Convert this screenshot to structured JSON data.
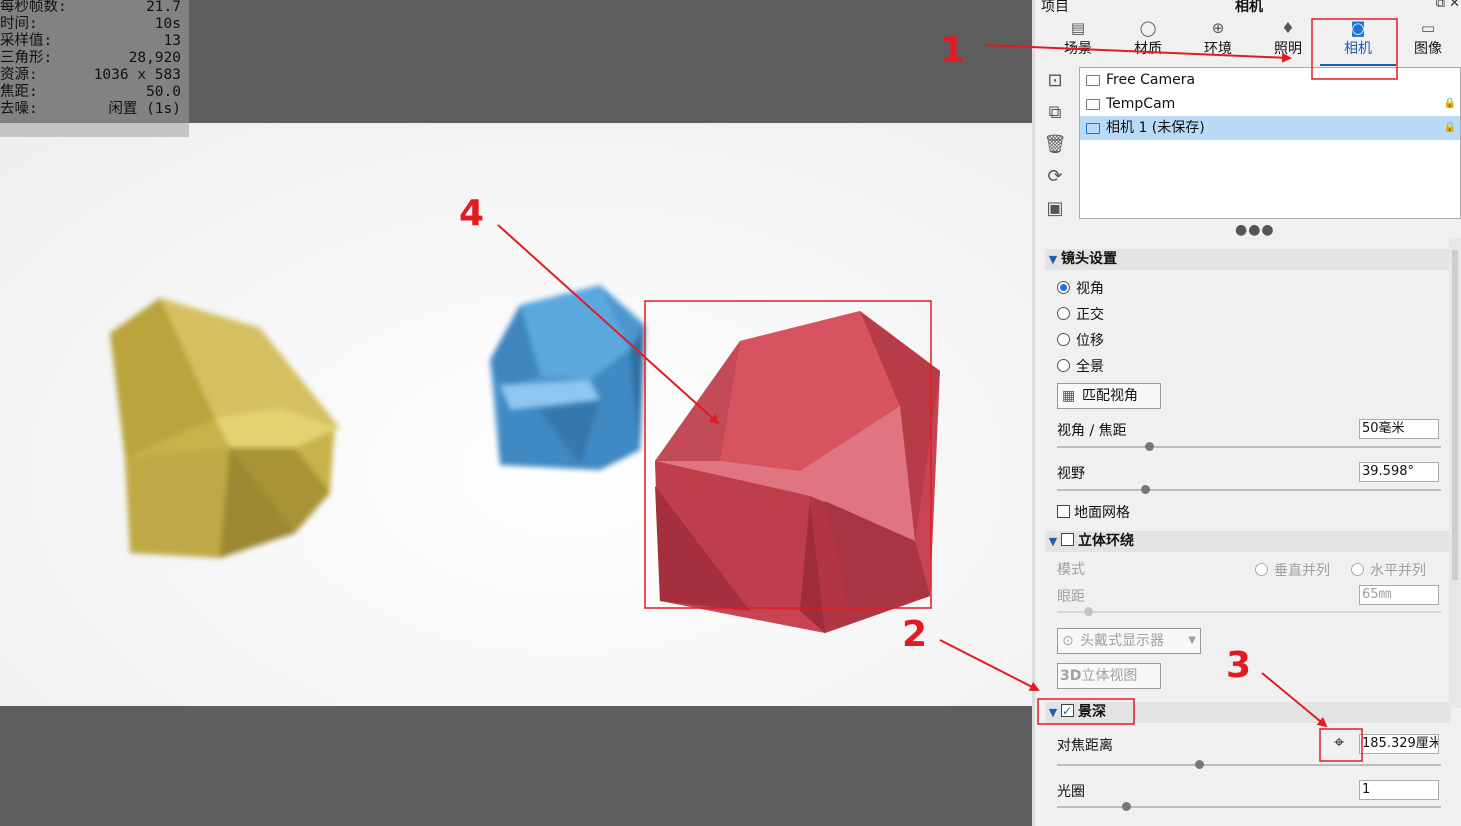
{
  "stats": [
    {
      "label": "每秒帧数:",
      "value": "21.7"
    },
    {
      "label": "时间:",
      "value": "10s"
    },
    {
      "label": "采样值:",
      "value": "13"
    },
    {
      "label": "三角形:",
      "value": "28,920"
    },
    {
      "label": "资源:",
      "value": "1036 x 583"
    },
    {
      "label": "焦距:",
      "value": "50.0"
    },
    {
      "label": "去噪:",
      "value": "闲置 (1s)"
    }
  ],
  "panel": {
    "title_left": "项目",
    "title_center": "相机",
    "title_icons": "⧉ ✕",
    "tabs": [
      {
        "label": "场景",
        "icon": "scene-icon"
      },
      {
        "label": "材质",
        "icon": "material-icon"
      },
      {
        "label": "环境",
        "icon": "environment-icon"
      },
      {
        "label": "照明",
        "icon": "lighting-icon"
      },
      {
        "label": "相机",
        "icon": "camera-icon"
      },
      {
        "label": "图像",
        "icon": "image-icon"
      }
    ],
    "active_tab": "相机",
    "cameras": [
      {
        "name": "Free Camera",
        "locked": false,
        "selected": false
      },
      {
        "name": "TempCam",
        "locked": true,
        "selected": false
      },
      {
        "name": "相机 1 (未保存)",
        "locked": true,
        "selected": true
      }
    ],
    "more": "●●●",
    "lens": {
      "title": "镜头设置",
      "modes": [
        "视角",
        "正交",
        "位移",
        "全景"
      ],
      "selected_mode": "视角",
      "match_button": "匹配视角",
      "fov_focal_label": "视角 / 焦距",
      "fov_focal_value": "50毫米",
      "fov_focal_level": 0.24,
      "field_of_view_label": "视野",
      "field_of_view_value": "39.598°",
      "field_of_view_level": 0.23,
      "ground_grid_label": "地面网格"
    },
    "stereo": {
      "title": "立体环绕",
      "mode_label": "模式",
      "mode_options": [
        "垂直并列",
        "水平并列"
      ],
      "eye_distance_label": "眼距",
      "eye_distance_value": "65㎜",
      "eye_distance_level": 0.08,
      "hmd_button": "头戴式显示器",
      "stereo_view_button": "立体视图",
      "stereo_view_prefix": "3D"
    },
    "dof": {
      "title": "景深",
      "checked": true,
      "focus_distance_label": "对焦距离",
      "focus_distance_value": "185.329厘米",
      "focus_distance_level": 0.37,
      "aperture_label": "光圈",
      "aperture_value": "1",
      "aperture_level": 0.18
    }
  },
  "annotations": [
    {
      "number": "1"
    },
    {
      "number": "2"
    },
    {
      "number": "3"
    },
    {
      "number": "4"
    }
  ],
  "colors": {
    "annotation": "#e21b22",
    "accent": "#1b5fb3",
    "chair_yellow": "#c9b54a",
    "chair_blue": "#4f9ad4",
    "chair_red": "#cf4b58"
  }
}
